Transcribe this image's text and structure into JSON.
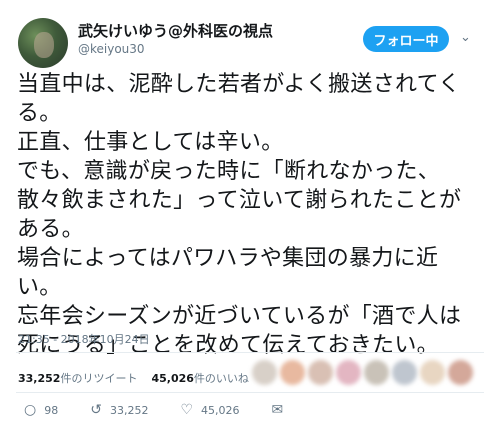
{
  "user": {
    "display_name": "武矢けいゆう@外科医の視点",
    "handle": "@keiyou30"
  },
  "follow_button": {
    "label": "フォロー中"
  },
  "tweet": {
    "lines": [
      "当直中は、泥酔した若者がよく搬送されてく",
      "る。",
      "正直、仕事としては辛い。",
      "でも、意識が戻った時に「断れなかった、",
      "散々飲まされた」って泣いて謝られたことが",
      "ある。",
      "場合によってはパワハラや集団の暴力に近",
      "い。",
      "忘年会シーズンが近づいているが「酒で人は",
      "死にうる」ことを改めて伝えておきたい。"
    ],
    "timestamp": "21:35 - 2018年10月24日"
  },
  "stats": {
    "retweet_count": "33,252",
    "retweet_label": "件のリツイート",
    "like_count": "45,026",
    "like_label": "件のいいね"
  },
  "actions": {
    "reply_count": "98",
    "retweet_count": "33,252",
    "like_count": "45,026"
  },
  "colors": {
    "accent": "#1da1f2",
    "muted": "#657786",
    "text": "#14171a",
    "divider": "#e6ecf0"
  }
}
